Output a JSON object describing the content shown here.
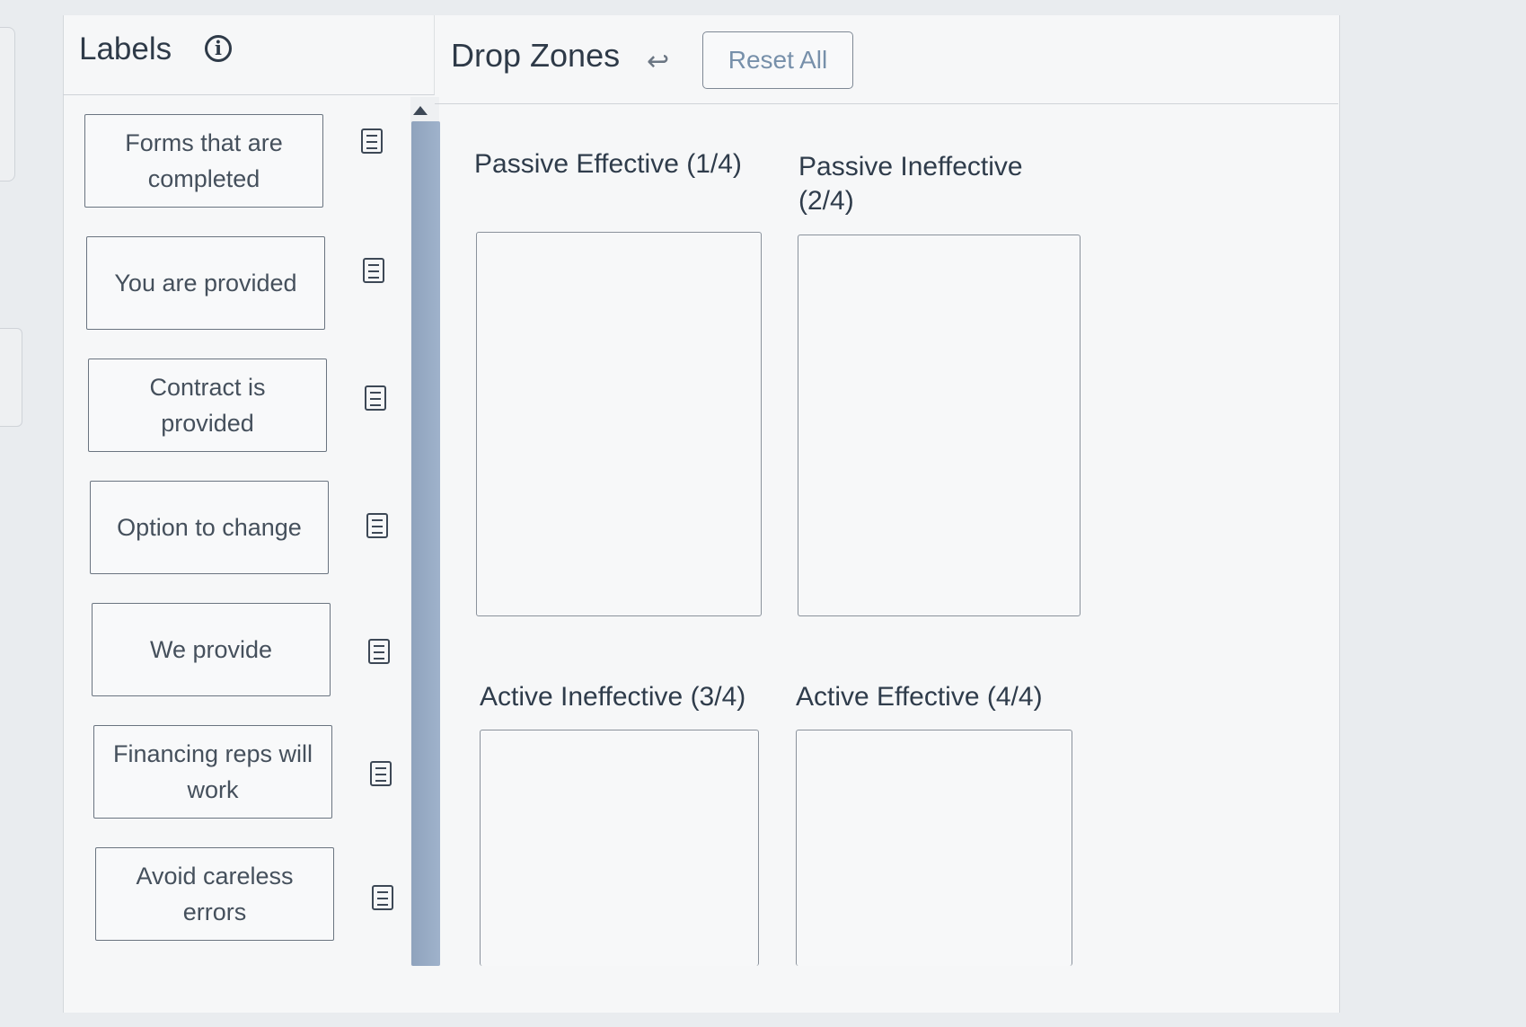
{
  "labels_panel": {
    "title": "Labels",
    "info_icon": "info-icon",
    "items": [
      {
        "text": "Forms that are completed",
        "icon": "note-icon"
      },
      {
        "text": "You are provided",
        "icon": "note-icon"
      },
      {
        "text": "Contract is provided",
        "icon": "note-icon"
      },
      {
        "text": "Option to change",
        "icon": "note-icon"
      },
      {
        "text": "We provide",
        "icon": "note-icon"
      },
      {
        "text": "Financing reps will work",
        "icon": "note-icon"
      },
      {
        "text": "Avoid careless errors",
        "icon": "note-icon"
      }
    ]
  },
  "drop_zones_panel": {
    "title": "Drop Zones",
    "undo_icon": "undo-arrow-icon",
    "reset_label": "Reset All",
    "zones": [
      {
        "title": "Passive Effective (1/4)"
      },
      {
        "title": "Passive Ineffective (2/4)"
      },
      {
        "title": "Active Ineffective (3/4)"
      },
      {
        "title": "Active Effective (4/4)"
      }
    ]
  },
  "colors": {
    "background": "#e9ecef",
    "panel": "#f6f7f8",
    "scrollbar_thumb": "#9fb2cb",
    "reset_text": "#7790aa",
    "text": "#2e3a48"
  }
}
